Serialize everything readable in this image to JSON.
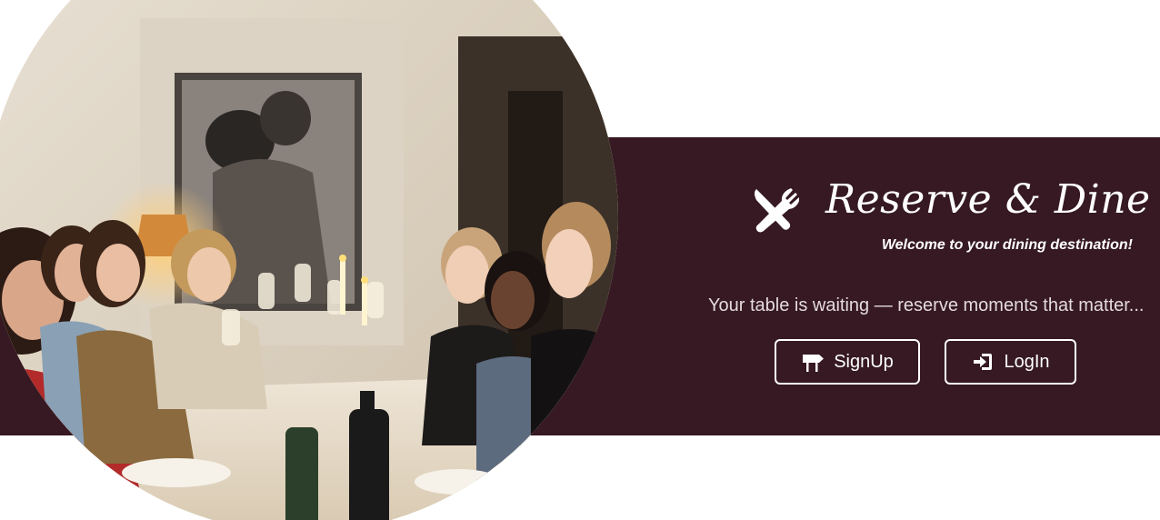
{
  "brand": {
    "title": "Reserve & Dine",
    "tagline": "Welcome to your dining destination!",
    "icon": "utensils-crossed-icon"
  },
  "hero": {
    "subtitle": "Your table is waiting — reserve moments that matter...",
    "image": "group-dinner-toast-photo"
  },
  "actions": {
    "signup_label": "SignUp",
    "signup_icon": "signpost-icon",
    "login_label": "LogIn",
    "login_icon": "sign-in-icon"
  },
  "colors": {
    "band": "#361922",
    "text": "#ffffff",
    "subtext": "#e4dadd"
  }
}
